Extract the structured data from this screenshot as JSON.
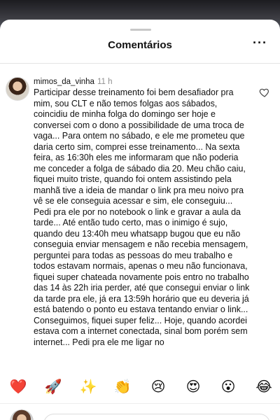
{
  "sheet": {
    "title": "Comentários",
    "more_label": "···"
  },
  "comment": {
    "username": "mimos_da_vinha",
    "time": "11 h",
    "text": "Participar desse treinamento foi bem desafiador pra mim, sou CLT e não temos folgas aos sábados, coincidiu de minha folga do domingo ser hoje e conversei com o dono a possibilidade de uma troca de vaga... Para ontem no sábado, e ele me prometeu que daria certo sim, comprei esse treinamento... Na sexta feira, as 16:30h eles me informaram que não poderia me conceder a folga de sábado dia 20. Meu chão caiu, fiquei muito triste, quando foi ontem assistindo pela manhã tive a ideia de mandar o link pra meu noivo pra vê se ele conseguia acessar e sim, ele conseguiu... Pedi pra ele por no notebook o link e gravar a aula da tarde... Até então tudo certo, mas o inimigo é sujo, quando deu 13:40h meu whatsapp bugou que eu não conseguia enviar mensagem e não recebia mensagem, perguntei para todas as pessoas do meu trabalho e todos estavam normais, apenas o meu não funcionava, fiquei super chateada novamente pois entro no trabalho das 14 às 22h iria perder, até que consegui enviar o link da tarde pra ele, já era 13:59h horário que eu deveria já está batendo o ponto eu estava tentando enviar o link... Conseguimos, fiquei super feliz... Hoje, quando acordei estava com a internet conectada, sinal bom porém sem internet... Pedi pra ele me ligar no"
  },
  "emoji_bar": {
    "items": [
      {
        "name": "red-heart",
        "glyph": "❤️"
      },
      {
        "name": "rocket",
        "glyph": "🚀"
      },
      {
        "name": "sparkles",
        "glyph": "✨"
      },
      {
        "name": "clapping-hands",
        "glyph": "👏"
      },
      {
        "name": "crying-face",
        "glyph": "😢"
      },
      {
        "name": "heart-eyes",
        "glyph": "😍"
      },
      {
        "name": "astonished-face",
        "glyph": "😮"
      },
      {
        "name": "tears-of-joy",
        "glyph": "😂"
      }
    ]
  },
  "colors": {
    "sheet_bg": "#ffffff",
    "secondary_text": "#8e8e8e",
    "primary_text": "#111111"
  }
}
